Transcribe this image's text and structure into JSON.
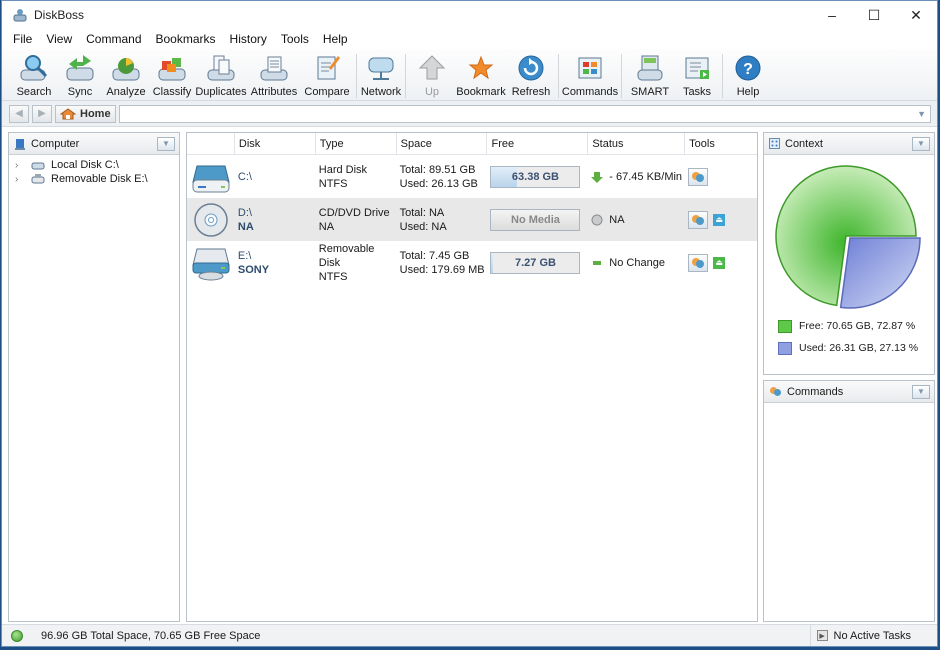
{
  "window": {
    "title": "DiskBoss",
    "controls": {
      "minimize": "–",
      "maximize": "☐",
      "close": "✕"
    }
  },
  "menu": [
    "File",
    "View",
    "Command",
    "Bookmarks",
    "History",
    "Tools",
    "Help"
  ],
  "toolbar": [
    {
      "label": "Search",
      "icon": "search-icon"
    },
    {
      "label": "Sync",
      "icon": "sync-icon"
    },
    {
      "label": "Analyze",
      "icon": "analyze-icon"
    },
    {
      "label": "Classify",
      "icon": "classify-icon"
    },
    {
      "label": "Duplicates",
      "icon": "duplicates-icon"
    },
    {
      "label": "Attributes",
      "icon": "attributes-icon"
    },
    {
      "label": "Compare",
      "icon": "compare-icon"
    },
    {
      "label": "Network",
      "icon": "network-icon"
    },
    {
      "label": "Up",
      "icon": "up-arrow-icon",
      "disabled": true
    },
    {
      "label": "Bookmark",
      "icon": "star-icon"
    },
    {
      "label": "Refresh",
      "icon": "refresh-icon"
    },
    {
      "label": "Commands",
      "icon": "commands-icon"
    },
    {
      "label": "SMART",
      "icon": "smart-icon"
    },
    {
      "label": "Tasks",
      "icon": "tasks-icon"
    },
    {
      "label": "Help",
      "icon": "help-icon"
    }
  ],
  "nav": {
    "home_label": "Home",
    "address": ""
  },
  "left_panel": {
    "title": "Computer",
    "tree": [
      {
        "label": "Local Disk C:\\"
      },
      {
        "label": "Removable Disk E:\\"
      }
    ]
  },
  "disks": {
    "columns": [
      "Disk",
      "Type",
      "Space",
      "Free",
      "Status",
      "Tools"
    ],
    "rows": [
      {
        "disk": "C:\\",
        "label": "",
        "type": "Hard Disk",
        "fs": "NTFS",
        "total": "Total: 89.51 GB",
        "used": "Used: 26.13 GB",
        "free": "63.38 GB",
        "free_fraction": 0.29,
        "status": "- 67.45 KB/Min",
        "status_icon": "arrow-down-green-icon",
        "icon": "hard-disk-icon",
        "eject": false
      },
      {
        "disk": "D:\\",
        "label": "NA",
        "type": "CD/DVD Drive",
        "fs": "NA",
        "total": "Total: NA",
        "used": "Used: NA",
        "free": "No Media",
        "free_fraction": 0,
        "status": "NA",
        "status_icon": "gray-circle-icon",
        "icon": "cd-dvd-icon",
        "eject": true,
        "eject_color": "#3ba3d6"
      },
      {
        "disk": "E:\\",
        "label": "SONY",
        "type": "Removable Disk",
        "fs": "NTFS",
        "total": "Total: 7.45 GB",
        "used": "Used: 179.69 MB",
        "free": "7.27 GB",
        "free_fraction": 0.02,
        "status": "No Change",
        "status_icon": "green-dash-icon",
        "icon": "removable-disk-icon",
        "eject": true,
        "eject_color": "#4cb84a"
      }
    ]
  },
  "context": {
    "title": "Context",
    "legend": [
      {
        "label": "Free: 70.65 GB, 72.87 %",
        "color": "#5ec948"
      },
      {
        "label": "Used: 26.31 GB, 27.13 %",
        "color": "#8f9fe0"
      }
    ]
  },
  "chart_data": {
    "type": "pie",
    "categories": [
      "Free",
      "Used"
    ],
    "values": [
      72.87,
      27.13
    ],
    "labels": [
      "Free: 70.65 GB, 72.87 %",
      "Used: 26.31 GB, 27.13 %"
    ],
    "colors": [
      "#5ec948",
      "#8f9fe0"
    ],
    "legend": "bottom"
  },
  "commands_panel": {
    "title": "Commands"
  },
  "statusbar": {
    "text": "96.96 GB Total Space, 70.65 GB Free Space",
    "tasks": "No Active Tasks"
  }
}
